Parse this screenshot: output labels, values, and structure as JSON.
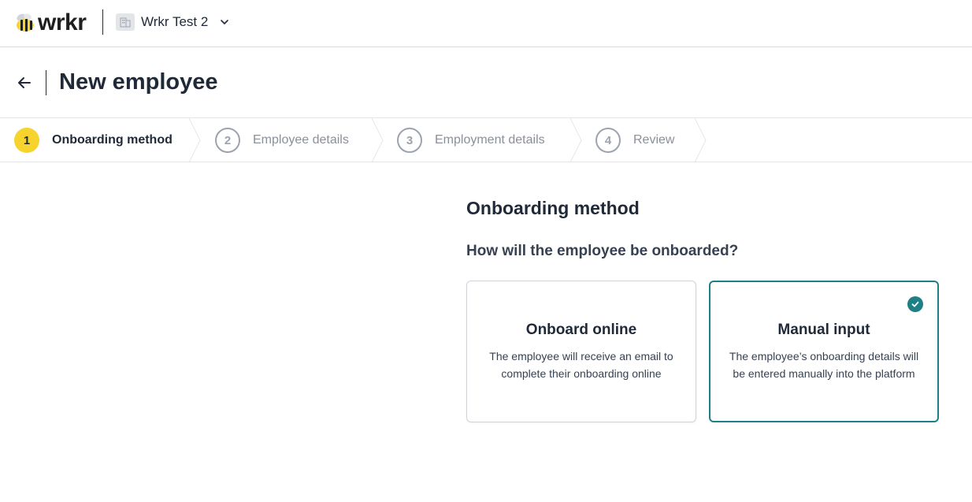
{
  "header": {
    "logo_text": "wrkr",
    "org_name": "Wrkr Test 2",
    "brand_color": "#f6d32d"
  },
  "page": {
    "title": "New employee"
  },
  "stepper": {
    "steps": [
      {
        "number": "1",
        "label": "Onboarding method",
        "state": "active"
      },
      {
        "number": "2",
        "label": "Employee details",
        "state": "inactive"
      },
      {
        "number": "3",
        "label": "Employment details",
        "state": "inactive"
      },
      {
        "number": "4",
        "label": "Review",
        "state": "inactive"
      }
    ]
  },
  "content": {
    "section_title": "Onboarding method",
    "question": "How will the employee be onboarded?",
    "options": [
      {
        "title": "Onboard online",
        "description": "The employee will receive an email to complete their onboarding online",
        "selected": false
      },
      {
        "title": "Manual input",
        "description": "The employee’s onboarding details will be entered manually into the platform",
        "selected": true
      }
    ],
    "selected_color": "#1f7f86"
  }
}
